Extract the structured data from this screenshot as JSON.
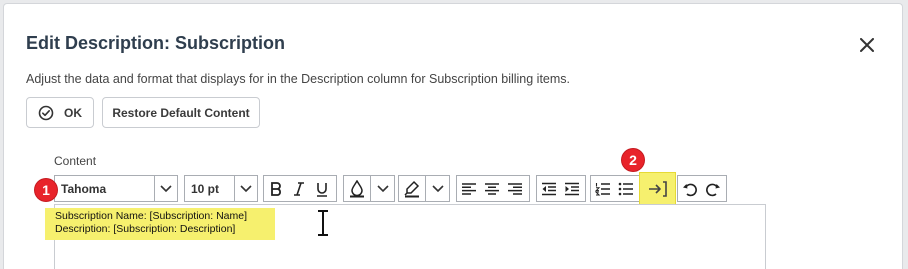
{
  "dialog": {
    "title": "Edit Description: Subscription",
    "description": "Adjust the data and format that displays for in the Description column for Subscription billing items."
  },
  "buttons": {
    "ok_label": "OK",
    "restore_label": "Restore Default Content"
  },
  "content": {
    "label": "Content",
    "font_family": "Tahoma",
    "font_size": "10 pt",
    "lines": [
      "Subscription Name: [Subscription: Name]",
      "Description: [Subscription: Description]"
    ]
  },
  "callouts": [
    "1",
    "2"
  ],
  "colors": {
    "highlight": "#f6f06e",
    "badge": "#e8232a",
    "title": "#2f3e4e"
  },
  "icons": [
    "close-icon",
    "check-circle-icon",
    "chevron-down-icon",
    "bold-icon",
    "italic-icon",
    "underline-icon",
    "font-color-icon",
    "highlight-pen-icon",
    "align-left-icon",
    "align-center-icon",
    "align-right-icon",
    "outdent-icon",
    "indent-icon",
    "numbered-list-icon",
    "bullet-list-icon",
    "insert-field-icon",
    "undo-icon",
    "redo-icon",
    "text-cursor-icon"
  ]
}
